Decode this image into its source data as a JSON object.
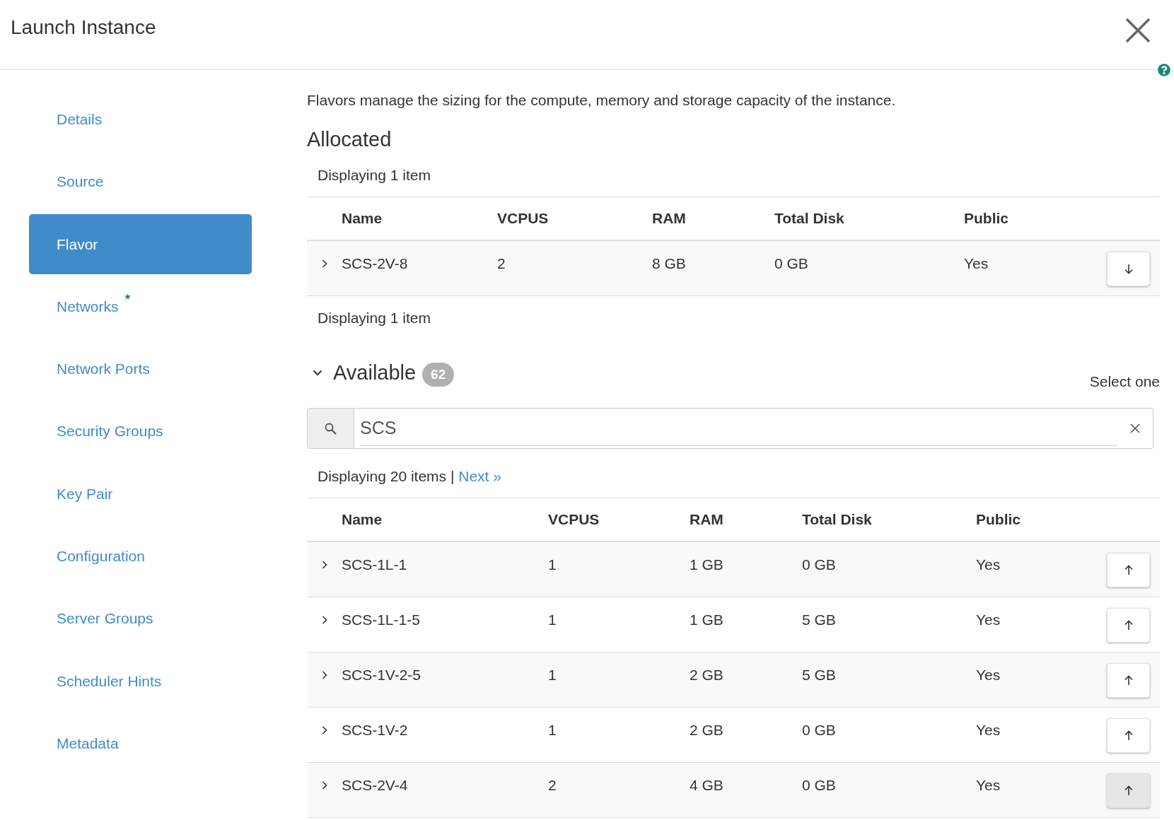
{
  "window": {
    "title": "Launch Instance"
  },
  "sidebar": {
    "items": [
      {
        "label": "Details",
        "selected": false,
        "required": false
      },
      {
        "label": "Source",
        "selected": false,
        "required": false
      },
      {
        "label": "Flavor",
        "selected": true,
        "required": false
      },
      {
        "label": "Networks",
        "selected": false,
        "required": true
      },
      {
        "label": "Network Ports",
        "selected": false,
        "required": false
      },
      {
        "label": "Security Groups",
        "selected": false,
        "required": false
      },
      {
        "label": "Key Pair",
        "selected": false,
        "required": false
      },
      {
        "label": "Configuration",
        "selected": false,
        "required": false
      },
      {
        "label": "Server Groups",
        "selected": false,
        "required": false
      },
      {
        "label": "Scheduler Hints",
        "selected": false,
        "required": false
      },
      {
        "label": "Metadata",
        "selected": false,
        "required": false
      }
    ]
  },
  "content": {
    "intro": "Flavors manage the sizing for the compute, memory and storage capacity of the instance.",
    "allocated": {
      "kind": "allocated",
      "title": "Allocated",
      "caption": "Displaying 1 item",
      "columns": [
        "Name",
        "VCPUS",
        "RAM",
        "Total Disk",
        "Public"
      ],
      "rows": [
        {
          "cells": [
            "SCS-2V-8",
            "2",
            "8 GB",
            "0 GB",
            "Yes"
          ],
          "expanded": false,
          "hovered": false
        }
      ],
      "footer_caption": "Displaying 1 item"
    },
    "available": {
      "kind": "available",
      "title": "Available",
      "badge": "62",
      "expanded": true,
      "hint": "Select one",
      "search": {
        "value": "SCS"
      },
      "caption": "Displaying 20 items |",
      "next_link": "Next »",
      "columns": [
        "Name",
        "VCPUS",
        "RAM",
        "Total Disk",
        "Public"
      ],
      "rows": [
        {
          "cells": [
            "SCS-1L-1",
            "1",
            "1 GB",
            "0 GB",
            "Yes"
          ],
          "expanded": false,
          "hovered": false
        },
        {
          "cells": [
            "SCS-1L-1-5",
            "1",
            "1 GB",
            "5 GB",
            "Yes"
          ],
          "expanded": false,
          "hovered": false
        },
        {
          "cells": [
            "SCS-1V-2-5",
            "1",
            "2 GB",
            "5 GB",
            "Yes"
          ],
          "expanded": false,
          "hovered": false
        },
        {
          "cells": [
            "SCS-1V-2",
            "1",
            "2 GB",
            "0 GB",
            "Yes"
          ],
          "expanded": false,
          "hovered": false
        },
        {
          "cells": [
            "SCS-2V-4",
            "2",
            "4 GB",
            "0 GB",
            "Yes"
          ],
          "expanded": false,
          "hovered": true
        }
      ]
    }
  }
}
